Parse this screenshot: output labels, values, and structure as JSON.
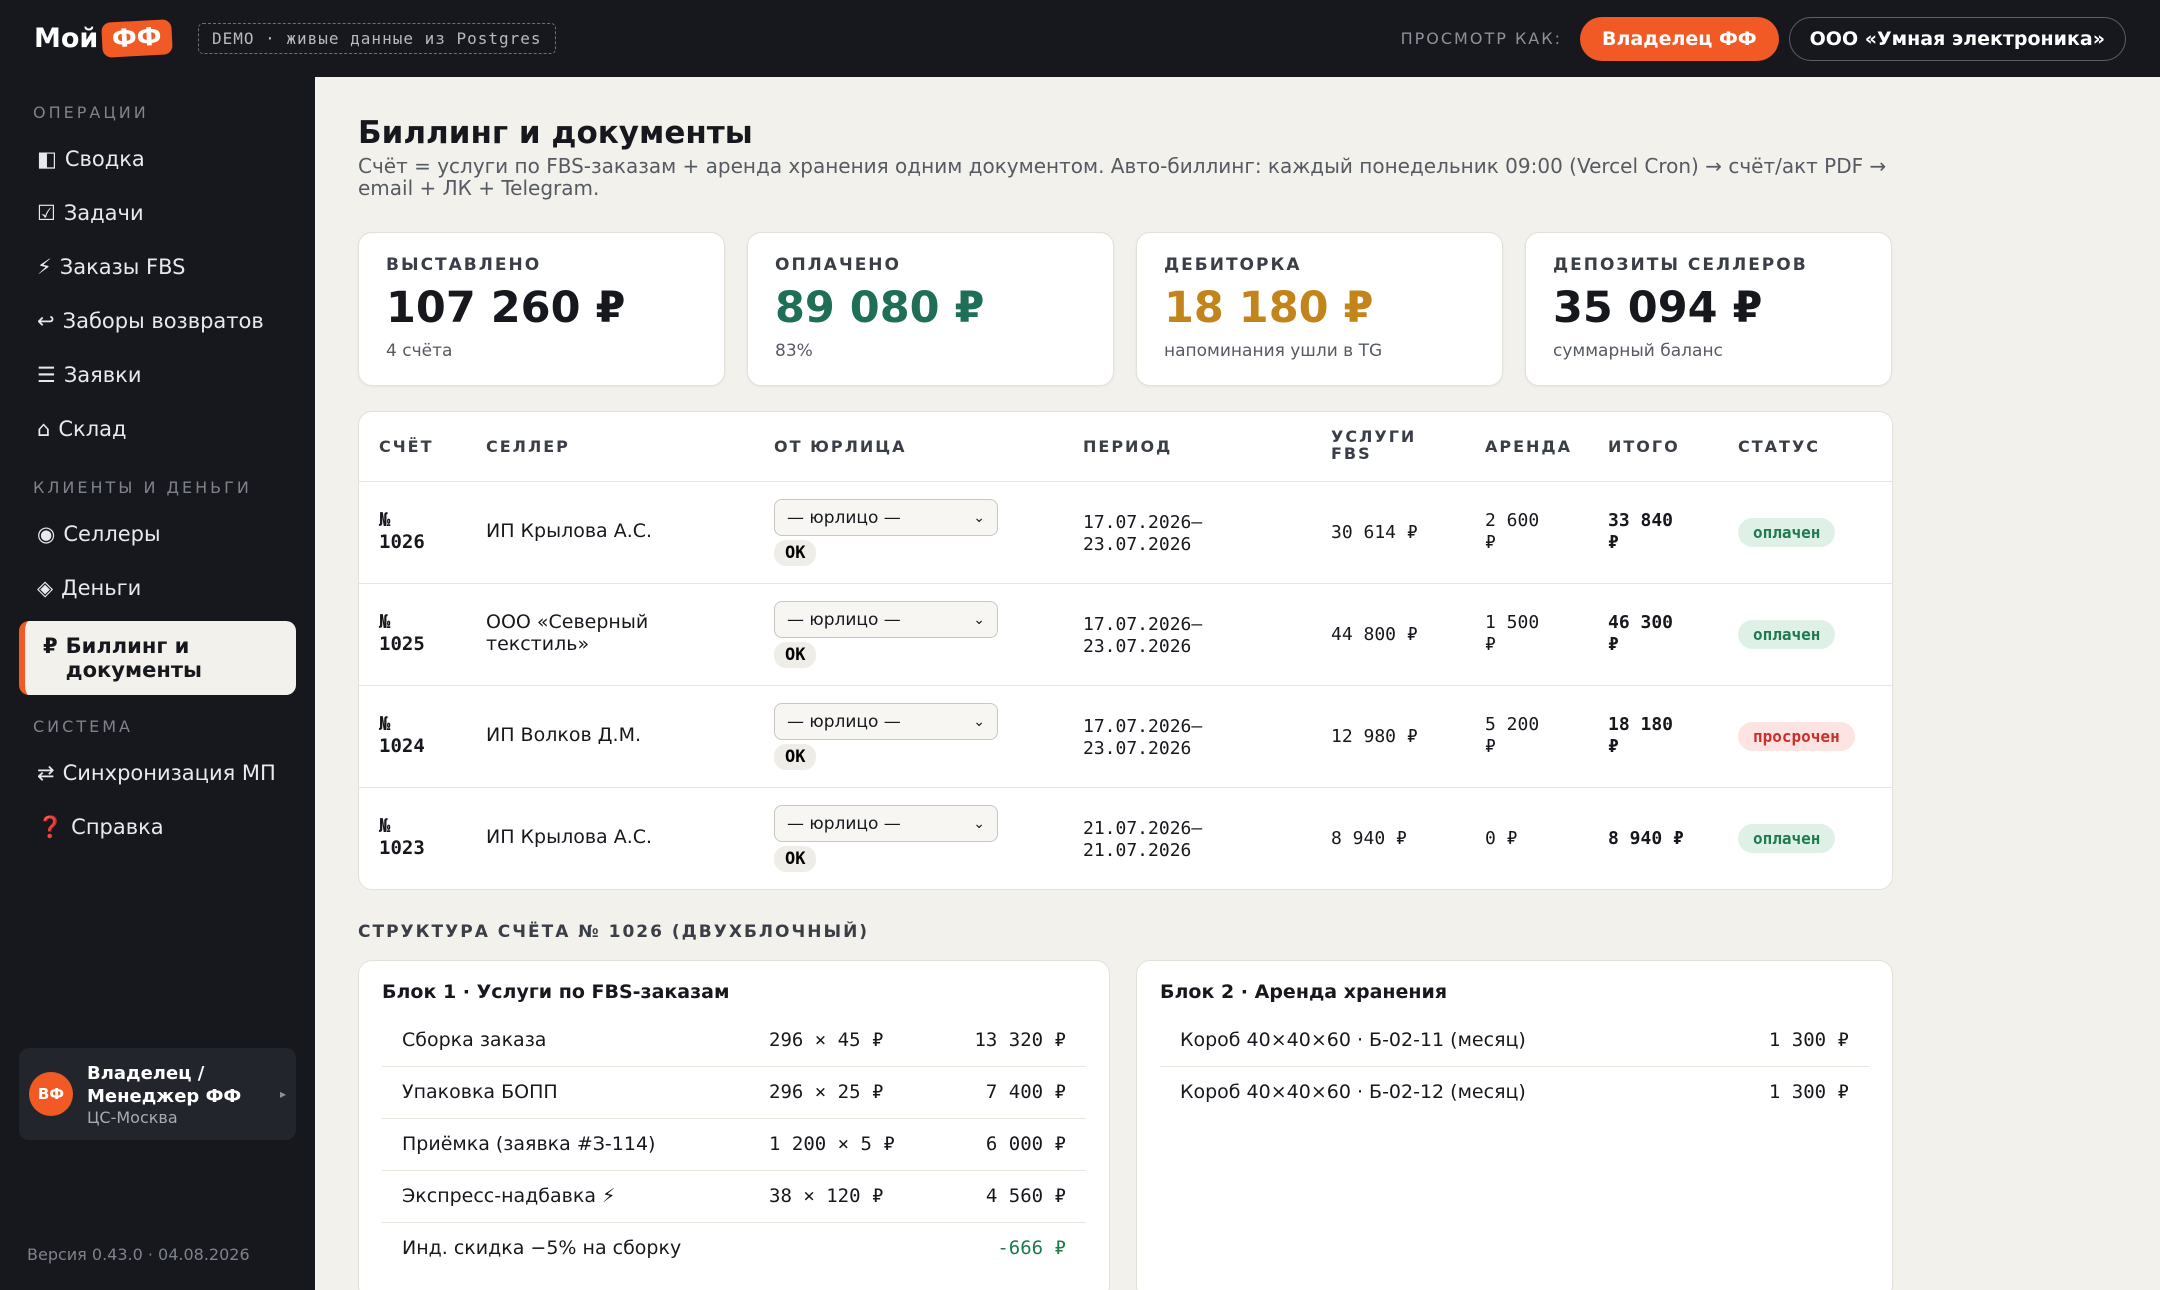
{
  "topbar": {
    "logo_text": "Мой",
    "logo_badge": "ФФ",
    "demo_chip": "DEMO · живые данные из Postgres",
    "view_as": "ПРОСМОТР КАК:",
    "role": "Владелец ФФ",
    "org": "ООО «Умная электроника»"
  },
  "sidebar": {
    "sections": [
      {
        "label": "ОПЕРАЦИИ",
        "items": [
          {
            "icon": "◧",
            "label": "Сводка"
          },
          {
            "icon": "☑",
            "label": "Задачи"
          },
          {
            "icon": "⚡",
            "label": "Заказы FBS"
          },
          {
            "icon": "↩",
            "label": "Заборы возвратов"
          },
          {
            "icon": "☰",
            "label": "Заявки"
          },
          {
            "icon": "⌂",
            "label": "Склад"
          }
        ]
      },
      {
        "label": "КЛИЕНТЫ И ДЕНЬГИ",
        "items": [
          {
            "icon": "◉",
            "label": "Селлеры"
          },
          {
            "icon": "◈",
            "label": "Деньги"
          },
          {
            "icon": "₽",
            "label": "Биллинг и документы"
          }
        ]
      },
      {
        "label": "СИСТЕМА",
        "items": [
          {
            "icon": "⇄",
            "label": "Синхронизация МП"
          },
          {
            "icon": "❓",
            "label": "Справка"
          }
        ]
      }
    ],
    "user": {
      "initials": "ВФ",
      "name": "Владелец / Менеджер ФФ",
      "location": "ЦС-Москва",
      "arrow": "▸"
    },
    "version": "Версия 0.43.0 · 04.08.2026"
  },
  "page": {
    "title": "Биллинг и документы",
    "description": "Счёт = услуги по FBS-заказам + аренда хранения одним документом. Авто-биллинг: каждый понедельник 09:00 (Vercel Cron) → счёт/акт PDF → email + ЛК + Telegram."
  },
  "kpis": [
    {
      "label": "ВЫСТАВЛЕНО",
      "value": "107 260 ₽",
      "sub": "4 счёта",
      "color": "#16181d"
    },
    {
      "label": "ОПЛАЧЕНО",
      "value": "89 080 ₽",
      "sub": "83%",
      "color": "#1f6e57"
    },
    {
      "label": "ДЕБИТОРКА",
      "value": "18 180 ₽",
      "sub": "напоминания ушли в TG",
      "color": "#c2841b"
    },
    {
      "label": "ДЕПОЗИТЫ СЕЛЛЕРОВ",
      "value": "35 094 ₽",
      "sub": "суммарный баланс",
      "color": "#16181d"
    }
  ],
  "table": {
    "headers": {
      "invoice": "СЧЁТ",
      "seller": "СЕЛЛЕР",
      "legal": "ОТ ЮРЛИЦА",
      "period": "ПЕРИОД",
      "fbs_1": "УСЛУГИ",
      "fbs_2": "FBS",
      "rent": "АРЕНДА",
      "total": "ИТОГО",
      "status": "СТАТУС"
    },
    "select_placeholder": "— юрлицо —",
    "ok_label": "OK",
    "rows": [
      {
        "num_prefix": "№",
        "num": "1026",
        "seller": "ИП Крылова А.С.",
        "period_from": "17.07.2026–",
        "period_to": "23.07.2026",
        "fbs": "30 614 ₽",
        "rent_1": "2 600",
        "rent_2": "₽",
        "total_1": "33 840",
        "total_2": "₽",
        "status": "оплачен"
      },
      {
        "num_prefix": "№",
        "num": "1025",
        "seller": "ООО «Северный текстиль»",
        "period_from": "17.07.2026–",
        "period_to": "23.07.2026",
        "fbs": "44 800 ₽",
        "rent_1": "1 500",
        "rent_2": "₽",
        "total_1": "46 300",
        "total_2": "₽",
        "status": "оплачен"
      },
      {
        "num_prefix": "№",
        "num": "1024",
        "seller": "ИП Волков Д.М.",
        "period_from": "17.07.2026–",
        "period_to": "23.07.2026",
        "fbs": "12 980 ₽",
        "rent_1": "5 200",
        "rent_2": "₽",
        "total_1": "18 180",
        "total_2": "₽",
        "status": "просрочен"
      },
      {
        "num_prefix": "№",
        "num": "1023",
        "seller": "ИП Крылова А.С.",
        "period_from": "21.07.2026–",
        "period_to": "21.07.2026",
        "fbs": "8 940 ₽",
        "rent_1": "0 ₽",
        "rent_2": "",
        "total_1": "8 940 ₽",
        "total_2": "",
        "status": "оплачен"
      }
    ]
  },
  "structure": {
    "label": "СТРУКТУРА СЧЁТА № 1026 (ДВУХБЛОЧНЫЙ)",
    "block1": {
      "title": "Блок 1 · Услуги по FBS-заказам",
      "lines": [
        {
          "name": "Сборка заказа",
          "qty": "296 × 45 ₽",
          "sum": "13 320 ₽"
        },
        {
          "name": "Упаковка БОПП",
          "qty": "296 × 25 ₽",
          "sum": "7 400 ₽"
        },
        {
          "name": "Приёмка (заявка #З-114)",
          "qty": "1 200 × 5 ₽",
          "sum": "6 000 ₽"
        },
        {
          "name": "Экспресс-надбавка ⚡",
          "qty": "38 × 120 ₽",
          "sum": "4 560 ₽"
        },
        {
          "name": "Инд. скидка −5% на сборку",
          "qty": "",
          "sum": "-666 ₽"
        }
      ]
    },
    "block2": {
      "title": "Блок 2 · Аренда хранения",
      "lines": [
        {
          "name": "Короб 40×40×60 · Б-02-11 (месяц)",
          "sum": "1 300 ₽"
        },
        {
          "name": "Короб 40×40×60 · Б-02-12 (месяц)",
          "sum": "1 300 ₽"
        }
      ]
    }
  }
}
